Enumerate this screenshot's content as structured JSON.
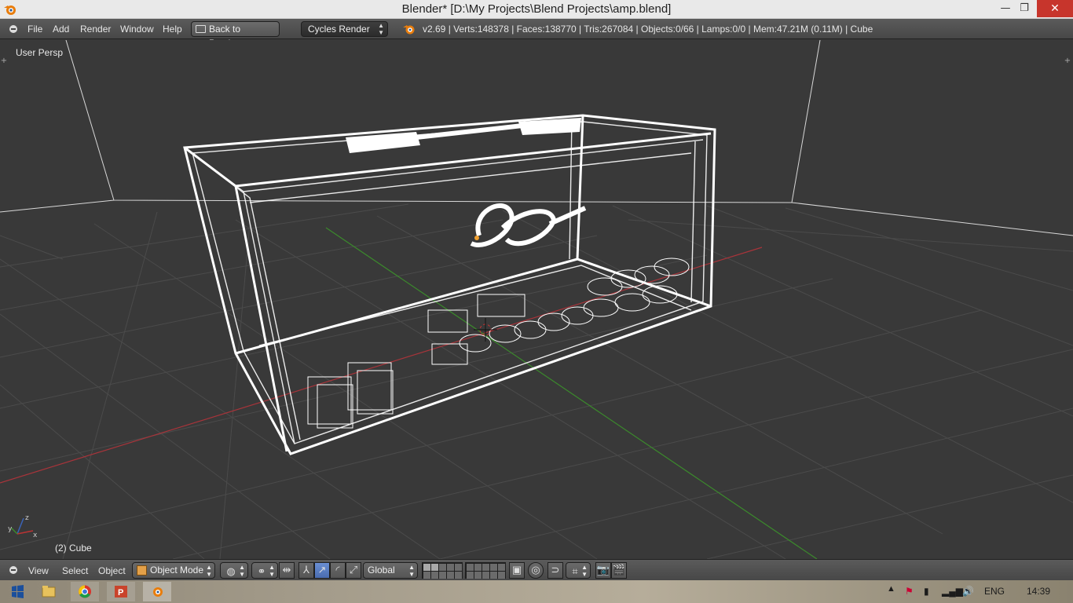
{
  "window": {
    "title": "Blender* [D:\\My Projects\\Blend Projects\\amp.blend]",
    "minimize_glyph": "—",
    "restore_glyph": "❐",
    "close_glyph": "✕"
  },
  "info_header": {
    "menus": [
      "File",
      "Add",
      "Render",
      "Window",
      "Help"
    ],
    "back_button": "Back to Previous",
    "render_engine": "Cycles Render",
    "stats": "v2.69 | Verts:148378 | Faces:138770 | Tris:267084 | Objects:0/66 | Lamps:0/0 | Mem:47.21M (0.11M) | Cube"
  },
  "viewport": {
    "perspective_label": "User Persp",
    "active_object_label": "(2) Cube",
    "background_color": "#393939",
    "wire_color": "#ffffff",
    "x_axis_color": "#a8343a",
    "y_axis_color": "#3b8a2c"
  },
  "view3d_header": {
    "menus": [
      "View",
      "Select",
      "Object"
    ],
    "mode": "Object Mode",
    "orientation": "Global",
    "active_color": "#5b7fc4"
  },
  "taskbar": {
    "apps": [
      "windows-start",
      "file-explorer",
      "chrome",
      "powerpoint",
      "blender"
    ],
    "language": "ENG",
    "time": "14:39"
  }
}
